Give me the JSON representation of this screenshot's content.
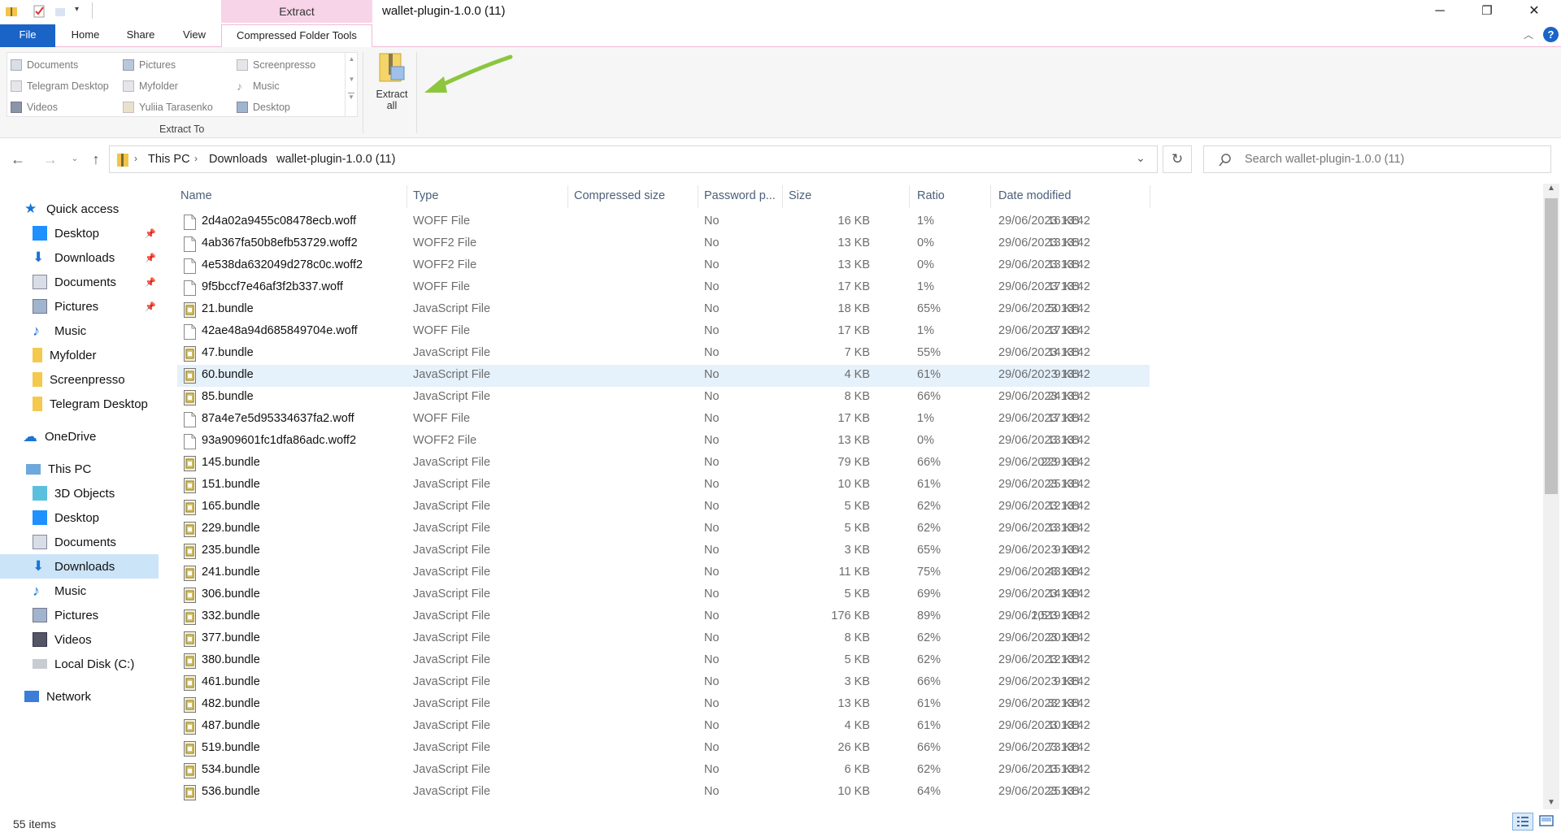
{
  "window": {
    "title": "wallet-plugin-1.0.0 (11)",
    "context_tab": "Extract",
    "min": "─",
    "max": "❐",
    "close": "✕",
    "help": "?"
  },
  "ribbon": {
    "tabs": [
      "File",
      "Home",
      "Share",
      "View",
      "Compressed Folder Tools"
    ],
    "destinations": [
      {
        "label": "Documents",
        "icon": "documents-icon"
      },
      {
        "label": "Pictures",
        "icon": "pictures-icon"
      },
      {
        "label": "Screenpresso",
        "icon": "folder-icon"
      },
      {
        "label": "Telegram Desktop",
        "icon": "folder-icon"
      },
      {
        "label": "Myfolder",
        "icon": "folder-icon"
      },
      {
        "label": "Music",
        "icon": "music-icon"
      },
      {
        "label": "Videos",
        "icon": "videos-icon"
      },
      {
        "label": "Yuliia Tarasenko",
        "icon": "user-folder-icon"
      },
      {
        "label": "Desktop",
        "icon": "desktop-icon"
      }
    ],
    "extract_to_label": "Extract To",
    "extract_all_line1": "Extract",
    "extract_all_line2": "all"
  },
  "address": {
    "crumbs": [
      "This PC",
      "Downloads",
      "wallet-plugin-1.0.0 (11)"
    ],
    "search_placeholder": "Search wallet-plugin-1.0.0 (11)"
  },
  "nav": {
    "quick_access": "Quick access",
    "quick_items": [
      {
        "label": "Desktop",
        "pinned": true
      },
      {
        "label": "Downloads",
        "pinned": true
      },
      {
        "label": "Documents",
        "pinned": true
      },
      {
        "label": "Pictures",
        "pinned": true
      },
      {
        "label": "Music",
        "pinned": false
      },
      {
        "label": "Myfolder",
        "pinned": false
      },
      {
        "label": "Screenpresso",
        "pinned": false
      },
      {
        "label": "Telegram Desktop",
        "pinned": false
      }
    ],
    "onedrive": "OneDrive",
    "this_pc": "This PC",
    "pc_items": [
      "3D Objects",
      "Desktop",
      "Documents",
      "Downloads",
      "Music",
      "Pictures",
      "Videos",
      "Local Disk (C:)"
    ],
    "network": "Network",
    "selected": "Downloads"
  },
  "columns": {
    "name": "Name",
    "type": "Type",
    "compressed": "Compressed size",
    "password": "Password p...",
    "size": "Size",
    "ratio": "Ratio",
    "date": "Date modified"
  },
  "files": [
    {
      "name": "2d4a02a9455c08478ecb.woff",
      "type": "WOFF File",
      "csize": "16 KB",
      "pwd": "No",
      "size": "16 KB",
      "ratio": "1%",
      "date": "29/06/2023 13:42"
    },
    {
      "name": "4ab367fa50b8efb53729.woff2",
      "type": "WOFF2 File",
      "csize": "13 KB",
      "pwd": "No",
      "size": "13 KB",
      "ratio": "0%",
      "date": "29/06/2023 13:42"
    },
    {
      "name": "4e538da632049d278c0c.woff2",
      "type": "WOFF2 File",
      "csize": "13 KB",
      "pwd": "No",
      "size": "13 KB",
      "ratio": "0%",
      "date": "29/06/2023 13:42"
    },
    {
      "name": "9f5bccf7e46af3f2b337.woff",
      "type": "WOFF File",
      "csize": "17 KB",
      "pwd": "No",
      "size": "17 KB",
      "ratio": "1%",
      "date": "29/06/2023 13:42"
    },
    {
      "name": "21.bundle",
      "type": "JavaScript File",
      "csize": "18 KB",
      "pwd": "No",
      "size": "50 KB",
      "ratio": "65%",
      "date": "29/06/2023 13:42"
    },
    {
      "name": "42ae48a94d685849704e.woff",
      "type": "WOFF File",
      "csize": "17 KB",
      "pwd": "No",
      "size": "17 KB",
      "ratio": "1%",
      "date": "29/06/2023 13:42"
    },
    {
      "name": "47.bundle",
      "type": "JavaScript File",
      "csize": "7 KB",
      "pwd": "No",
      "size": "14 KB",
      "ratio": "55%",
      "date": "29/06/2023 13:42"
    },
    {
      "name": "60.bundle",
      "type": "JavaScript File",
      "csize": "4 KB",
      "pwd": "No",
      "size": "9 KB",
      "ratio": "61%",
      "date": "29/06/2023 13:42",
      "selected": true
    },
    {
      "name": "85.bundle",
      "type": "JavaScript File",
      "csize": "8 KB",
      "pwd": "No",
      "size": "24 KB",
      "ratio": "66%",
      "date": "29/06/2023 13:42"
    },
    {
      "name": "87a4e7e5d95334637fa2.woff",
      "type": "WOFF File",
      "csize": "17 KB",
      "pwd": "No",
      "size": "17 KB",
      "ratio": "1%",
      "date": "29/06/2023 13:42"
    },
    {
      "name": "93a909601fc1dfa86adc.woff2",
      "type": "WOFF2 File",
      "csize": "13 KB",
      "pwd": "No",
      "size": "13 KB",
      "ratio": "0%",
      "date": "29/06/2023 13:42"
    },
    {
      "name": "145.bundle",
      "type": "JavaScript File",
      "csize": "79 KB",
      "pwd": "No",
      "size": "229 KB",
      "ratio": "66%",
      "date": "29/06/2023 13:42"
    },
    {
      "name": "151.bundle",
      "type": "JavaScript File",
      "csize": "10 KB",
      "pwd": "No",
      "size": "25 KB",
      "ratio": "61%",
      "date": "29/06/2023 13:42"
    },
    {
      "name": "165.bundle",
      "type": "JavaScript File",
      "csize": "5 KB",
      "pwd": "No",
      "size": "12 KB",
      "ratio": "62%",
      "date": "29/06/2023 13:42"
    },
    {
      "name": "229.bundle",
      "type": "JavaScript File",
      "csize": "5 KB",
      "pwd": "No",
      "size": "13 KB",
      "ratio": "62%",
      "date": "29/06/2023 13:42"
    },
    {
      "name": "235.bundle",
      "type": "JavaScript File",
      "csize": "3 KB",
      "pwd": "No",
      "size": "9 KB",
      "ratio": "65%",
      "date": "29/06/2023 13:42"
    },
    {
      "name": "241.bundle",
      "type": "JavaScript File",
      "csize": "11 KB",
      "pwd": "No",
      "size": "43 KB",
      "ratio": "75%",
      "date": "29/06/2023 13:42"
    },
    {
      "name": "306.bundle",
      "type": "JavaScript File",
      "csize": "5 KB",
      "pwd": "No",
      "size": "14 KB",
      "ratio": "69%",
      "date": "29/06/2023 13:42"
    },
    {
      "name": "332.bundle",
      "type": "JavaScript File",
      "csize": "176 KB",
      "pwd": "No",
      "size": "1,519 KB",
      "ratio": "89%",
      "date": "29/06/2023 13:42"
    },
    {
      "name": "377.bundle",
      "type": "JavaScript File",
      "csize": "8 KB",
      "pwd": "No",
      "size": "20 KB",
      "ratio": "62%",
      "date": "29/06/2023 13:42"
    },
    {
      "name": "380.bundle",
      "type": "JavaScript File",
      "csize": "5 KB",
      "pwd": "No",
      "size": "12 KB",
      "ratio": "62%",
      "date": "29/06/2023 13:42"
    },
    {
      "name": "461.bundle",
      "type": "JavaScript File",
      "csize": "3 KB",
      "pwd": "No",
      "size": "9 KB",
      "ratio": "66%",
      "date": "29/06/2023 13:42"
    },
    {
      "name": "482.bundle",
      "type": "JavaScript File",
      "csize": "13 KB",
      "pwd": "No",
      "size": "32 KB",
      "ratio": "61%",
      "date": "29/06/2023 13:42"
    },
    {
      "name": "487.bundle",
      "type": "JavaScript File",
      "csize": "4 KB",
      "pwd": "No",
      "size": "10 KB",
      "ratio": "61%",
      "date": "29/06/2023 13:42"
    },
    {
      "name": "519.bundle",
      "type": "JavaScript File",
      "csize": "26 KB",
      "pwd": "No",
      "size": "73 KB",
      "ratio": "66%",
      "date": "29/06/2023 13:42"
    },
    {
      "name": "534.bundle",
      "type": "JavaScript File",
      "csize": "6 KB",
      "pwd": "No",
      "size": "15 KB",
      "ratio": "62%",
      "date": "29/06/2023 13:42"
    },
    {
      "name": "536.bundle",
      "type": "JavaScript File",
      "csize": "10 KB",
      "pwd": "No",
      "size": "25 KB",
      "ratio": "64%",
      "date": "29/06/2023 13:42"
    }
  ],
  "status": {
    "items": "55 items"
  },
  "colors": {
    "accent": "#1a64c8",
    "context_pink": "#f8d4e8",
    "selection": "#cce4f7",
    "arrow_green": "#8cc63f"
  }
}
